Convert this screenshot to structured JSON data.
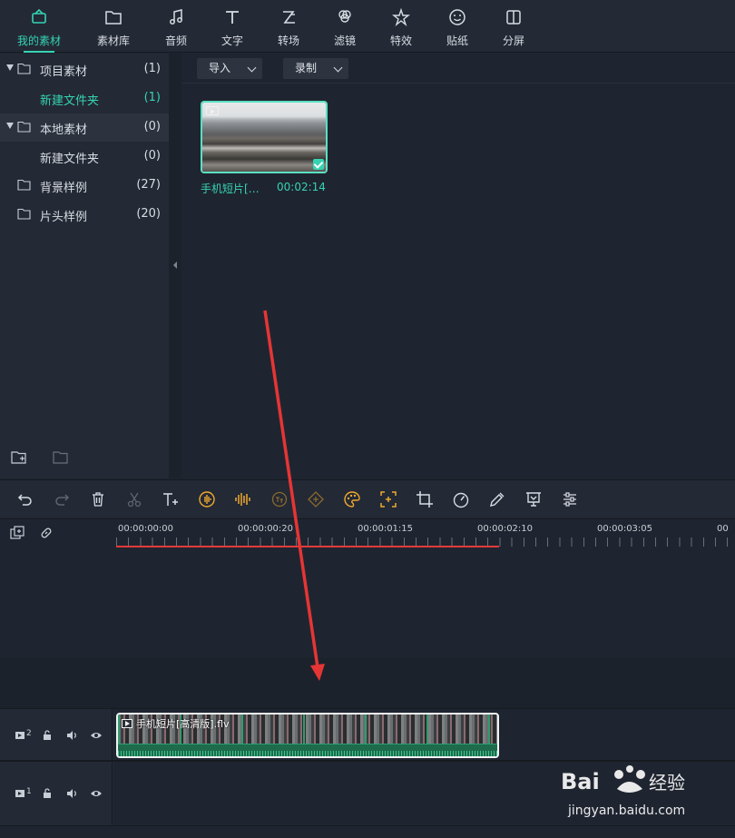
{
  "nav": {
    "items": [
      {
        "label": "我的素材",
        "icon": "my-media-icon",
        "active": true
      },
      {
        "label": "素材库",
        "icon": "folder-icon"
      },
      {
        "label": "音频",
        "icon": "music-note-icon"
      },
      {
        "label": "文字",
        "icon": "text-icon"
      },
      {
        "label": "转场",
        "icon": "transition-icon"
      },
      {
        "label": "滤镜",
        "icon": "filter-icon"
      },
      {
        "label": "特效",
        "icon": "effects-star-icon"
      },
      {
        "label": "贴纸",
        "icon": "sticker-icon"
      },
      {
        "label": "分屏",
        "icon": "split-screen-icon"
      }
    ],
    "accent": "#35d3b3"
  },
  "tree": {
    "items": [
      {
        "name": "项目素材",
        "count": "(1)"
      },
      {
        "name": "新建文件夹",
        "count": "(1)"
      },
      {
        "name": "本地素材",
        "count": "(0)"
      },
      {
        "name": "新建文件夹",
        "count": "(0)"
      },
      {
        "name": "背景样例",
        "count": "(27)"
      },
      {
        "name": "片头样例",
        "count": "(20)"
      }
    ]
  },
  "media": {
    "import_label": "导入",
    "record_label": "录制",
    "clip": {
      "name": "手机短片[…",
      "duration": "00:02:14"
    }
  },
  "timeline": {
    "ruler_labels": [
      "00:00:00:00",
      "00:00:00:20",
      "00:00:01:15",
      "00:00:02:10",
      "00:00:03:05",
      "00"
    ],
    "playhead_color": "#e33a3a",
    "tracks": [
      {
        "number": "2",
        "clip_name": "手机短片[高清版].flv"
      },
      {
        "number": "1"
      }
    ]
  },
  "watermark": {
    "logo": "Bai du 经验",
    "url": "jingyan.baidu.com"
  }
}
